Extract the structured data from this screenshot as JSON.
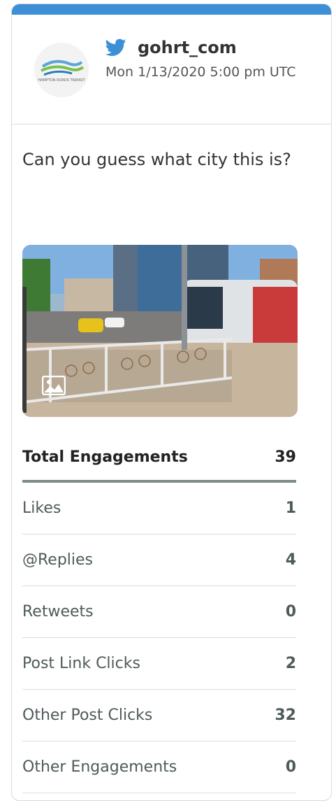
{
  "post": {
    "handle": "gohrt_com",
    "date": "Mon 1/13/2020 5:00 pm UTC",
    "text": "Can you guess what city this is?",
    "avatar_text": "HAMPTON ROADS TRANSIT",
    "icons": {
      "network": "twitter-bird-icon",
      "media": "image-icon"
    }
  },
  "colors": {
    "accent": "#3d8fd6",
    "total_border": "#7d8b8a"
  },
  "stats": {
    "total": {
      "label": "Total Engagements",
      "value": "39"
    },
    "rows": [
      {
        "label": "Likes",
        "value": "1"
      },
      {
        "label": "@Replies",
        "value": "4"
      },
      {
        "label": "Retweets",
        "value": "0"
      },
      {
        "label": "Post Link Clicks",
        "value": "2"
      },
      {
        "label": "Other Post Clicks",
        "value": "32"
      },
      {
        "label": "Other Engagements",
        "value": "0"
      }
    ]
  }
}
